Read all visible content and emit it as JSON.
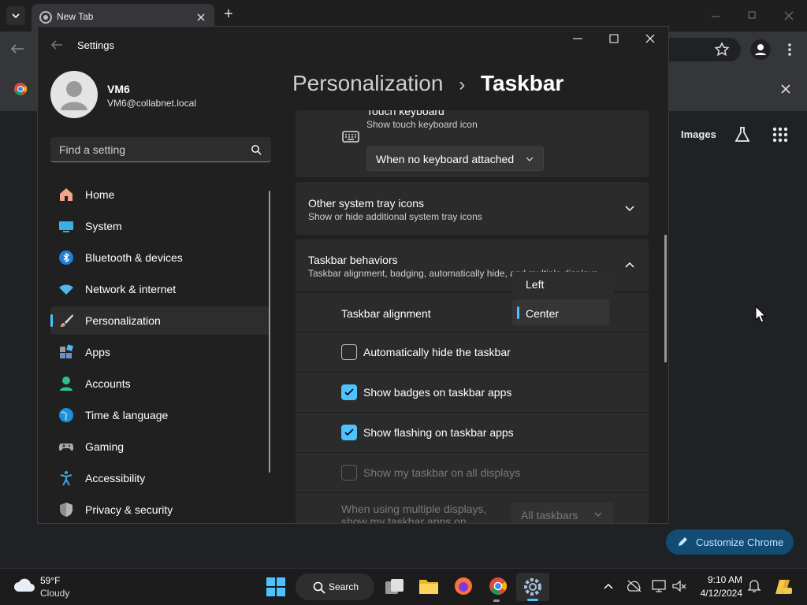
{
  "chrome": {
    "tab_title": "New Tab",
    "new_tab_symbol": "+",
    "page_links": {
      "images": "Images"
    },
    "customize_button": "Customize Chrome"
  },
  "settings": {
    "window_title": "Settings",
    "user": {
      "name": "VM6",
      "email": "VM6@collabnet.local"
    },
    "search_placeholder": "Find a setting",
    "nav": [
      {
        "label": "Home",
        "icon": "home-icon"
      },
      {
        "label": "System",
        "icon": "system-icon"
      },
      {
        "label": "Bluetooth & devices",
        "icon": "bluetooth-icon"
      },
      {
        "label": "Network & internet",
        "icon": "wifi-icon"
      },
      {
        "label": "Personalization",
        "icon": "brush-icon",
        "selected": true
      },
      {
        "label": "Apps",
        "icon": "apps-icon"
      },
      {
        "label": "Accounts",
        "icon": "account-icon"
      },
      {
        "label": "Time & language",
        "icon": "globe-icon"
      },
      {
        "label": "Gaming",
        "icon": "gamepad-icon"
      },
      {
        "label": "Accessibility",
        "icon": "accessibility-icon"
      },
      {
        "label": "Privacy & security",
        "icon": "shield-icon"
      }
    ],
    "breadcrumb": {
      "parent": "Personalization",
      "separator": "›",
      "current": "Taskbar"
    },
    "touch_keyboard": {
      "title": "Touch keyboard",
      "subtitle": "Show touch keyboard icon",
      "value": "When no keyboard attached"
    },
    "other_tray": {
      "title": "Other system tray icons",
      "subtitle": "Show or hide additional system tray icons"
    },
    "behaviors": {
      "title": "Taskbar behaviors",
      "subtitle": "Taskbar alignment, badging, automatically hide, and multiple displays"
    },
    "alignment": {
      "label": "Taskbar alignment",
      "options": [
        "Left",
        "Center"
      ],
      "selected": "Center"
    },
    "auto_hide": {
      "label": "Automatically hide the taskbar",
      "checked": false
    },
    "badges": {
      "label": "Show badges on taskbar apps",
      "checked": true
    },
    "flashing": {
      "label": "Show flashing on taskbar apps",
      "checked": true
    },
    "all_displays": {
      "label": "Show my taskbar on all displays",
      "checked": false,
      "disabled": true
    },
    "multi_display": {
      "label_line1": "When using multiple displays,",
      "label_line2": "show my taskbar apps on",
      "value": "All taskbars"
    }
  },
  "taskbar": {
    "weather": {
      "temp": "59°F",
      "condition": "Cloudy"
    },
    "search_label": "Search",
    "clock": {
      "time": "9:10 AM",
      "date": "4/12/2024"
    }
  },
  "colors": {
    "accent": "#4cc2ff",
    "window_bg": "#202020",
    "card_bg": "#2b2b2b"
  }
}
